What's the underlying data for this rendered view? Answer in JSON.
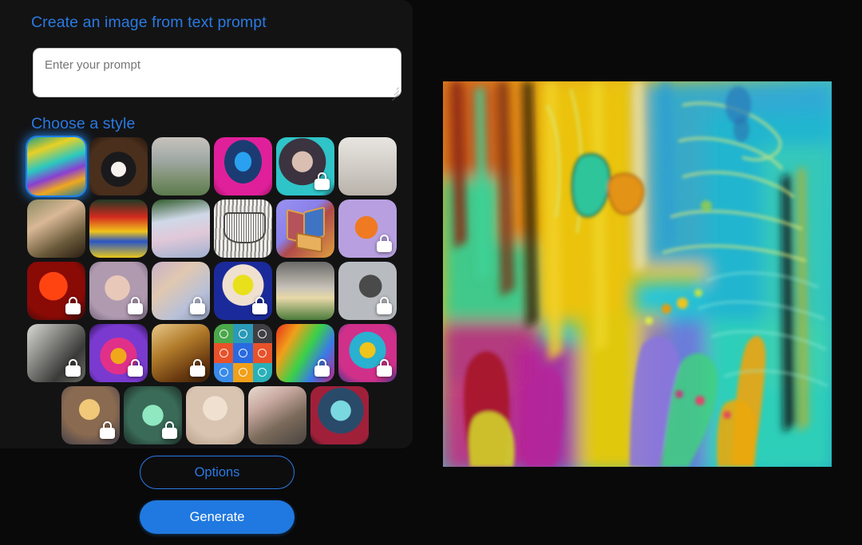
{
  "app": {
    "background": "#090909",
    "panel_background": "#131314",
    "accent": "#2a7ae2"
  },
  "left_panel": {
    "create_title": "Create an image from text prompt",
    "style_title": "Choose a style",
    "prompt": {
      "value": "",
      "placeholder": "Enter your prompt",
      "name": "prompt-textarea"
    },
    "buttons": {
      "options_label": "Options",
      "generate_label": "Generate"
    }
  },
  "style_grid": {
    "columns": 6,
    "selected_index": 0,
    "lock_icon": "lock-icon",
    "rows": [
      [
        {
          "name": "abstract-tropical",
          "locked": false,
          "selected": true
        },
        {
          "name": "panda-3d-render",
          "locked": false,
          "selected": false
        },
        {
          "name": "misty-landscape",
          "locked": false,
          "selected": false
        },
        {
          "name": "cyberpunk-robot",
          "locked": false,
          "selected": false
        },
        {
          "name": "portrait-teal-glow",
          "locked": true,
          "selected": false
        },
        {
          "name": "victorian-engraving",
          "locked": false,
          "selected": false
        }
      ],
      [
        {
          "name": "renaissance-portrait",
          "locked": false,
          "selected": false
        },
        {
          "name": "flower-still-life",
          "locked": false,
          "selected": false
        },
        {
          "name": "ballerinas-impressionist",
          "locked": false,
          "selected": false
        },
        {
          "name": "woodcut-teacup",
          "locked": false,
          "selected": false
        },
        {
          "name": "isometric-3d-icon",
          "locked": false,
          "selected": false
        },
        {
          "name": "fox-illustration",
          "locked": true,
          "selected": false
        }
      ],
      [
        {
          "name": "red-neon-skull",
          "locked": true,
          "selected": false
        },
        {
          "name": "soft-pastel-portrait",
          "locked": true,
          "selected": false
        },
        {
          "name": "dreamy-blur-abstract",
          "locked": true,
          "selected": false
        },
        {
          "name": "pop-art-blonde",
          "locked": true,
          "selected": false
        },
        {
          "name": "modern-architecture",
          "locked": false,
          "selected": false
        },
        {
          "name": "grey-soft-abstract",
          "locked": true,
          "selected": false
        }
      ],
      [
        {
          "name": "monochrome-texture",
          "locked": true,
          "selected": false
        },
        {
          "name": "neon-figure-purple",
          "locked": true,
          "selected": false
        },
        {
          "name": "warm-brown-blur",
          "locked": true,
          "selected": false
        },
        {
          "name": "flat-icon-grid",
          "locked": false,
          "selected": false
        },
        {
          "name": "rainbow-paint-streaks",
          "locked": true,
          "selected": false
        },
        {
          "name": "colorful-mosaic-portrait",
          "locked": true,
          "selected": false
        }
      ],
      [
        {
          "name": "golden-face-glow",
          "locked": true,
          "selected": false
        },
        {
          "name": "green-misty-figure",
          "locked": true,
          "selected": false
        },
        {
          "name": "porcelain-doll-portrait",
          "locked": false,
          "selected": false
        },
        {
          "name": "watercolor-soldier",
          "locked": false,
          "selected": false
        },
        {
          "name": "teal-red-portrait",
          "locked": false,
          "selected": false
        }
      ]
    ]
  },
  "result": {
    "name": "generated-image",
    "description": "Abstract tropical painting with yellow, teal, magenta and orange vertical strokes"
  }
}
